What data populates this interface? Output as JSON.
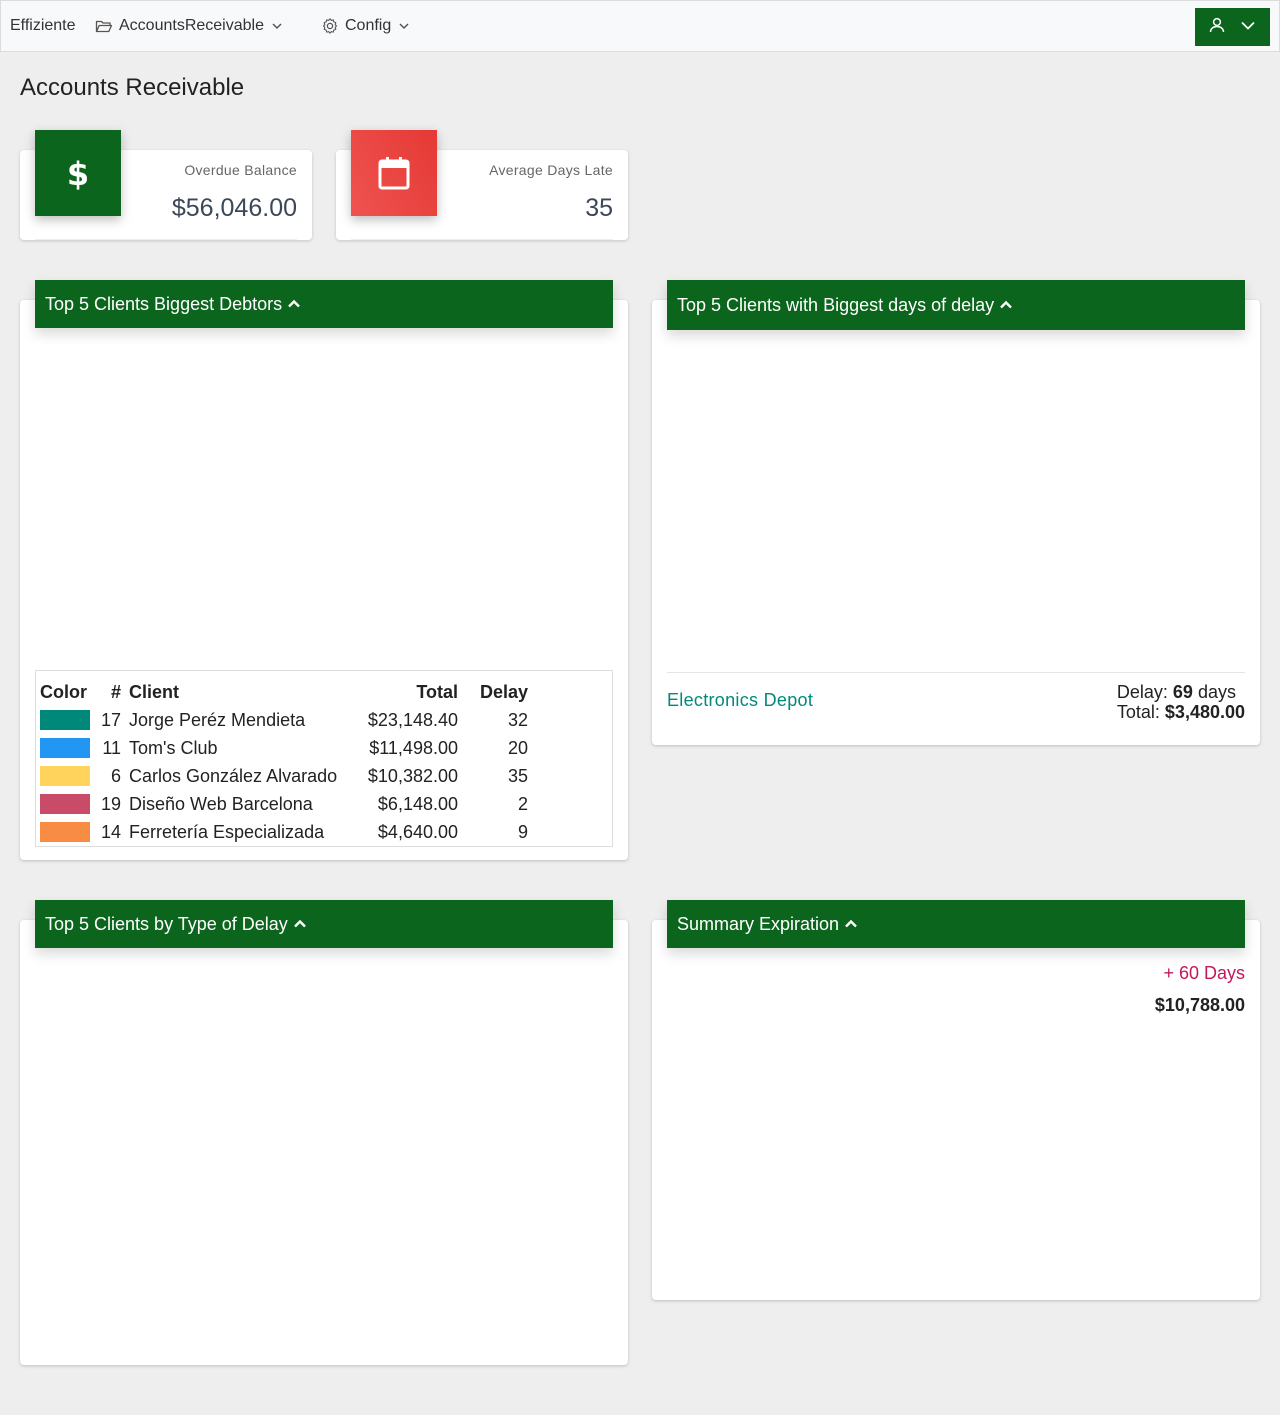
{
  "navbar": {
    "brand": "Effiziente",
    "menu_accounts": "AccountsReceivable",
    "menu_config": "Config"
  },
  "page_title": "Accounts Receivable",
  "stats": {
    "overdue": {
      "label": "Overdue Balance",
      "value": "$56,046.00",
      "color": "#0c651d"
    },
    "days_late": {
      "label": "Average Days Late",
      "value": "35",
      "color": "#e53935"
    }
  },
  "panels": {
    "debtors": {
      "title": "Top 5 Clients Biggest Debtors",
      "columns": [
        "Color",
        "#",
        "Client",
        "Total",
        "Delay"
      ],
      "rows": [
        {
          "color": "#00897b",
          "id": "17",
          "client": "Jorge Peréz Mendieta",
          "total": "$23,148.40",
          "delay": "32"
        },
        {
          "color": "#2196f3",
          "id": "11",
          "client": "Tom's Club",
          "total": "$11,498.00",
          "delay": "20"
        },
        {
          "color": "#ffd35c",
          "id": "6",
          "client": "Carlos González Alvarado",
          "total": "$10,382.00",
          "delay": "35"
        },
        {
          "color": "#c84b68",
          "id": "19",
          "client": "Diseño Web Barcelona",
          "total": "$6,148.00",
          "delay": "2"
        },
        {
          "color": "#f98c45",
          "id": "14",
          "client": "Ferretería Especializada",
          "total": "$4,640.00",
          "delay": "9"
        }
      ]
    },
    "delay": {
      "title": "Top 5 Clients with Biggest days of delay",
      "client": "Electronics Depot",
      "delay_label": "Delay:",
      "delay_value": "69",
      "delay_unit": "days",
      "total_label": "Total:",
      "total_value": "$3,480.00"
    },
    "type_delay": {
      "title": "Top 5 Clients by Type of Delay"
    },
    "summary": {
      "title": "Summary Expiration",
      "label": "+ 60 Days",
      "value": "$10,788.00"
    }
  }
}
